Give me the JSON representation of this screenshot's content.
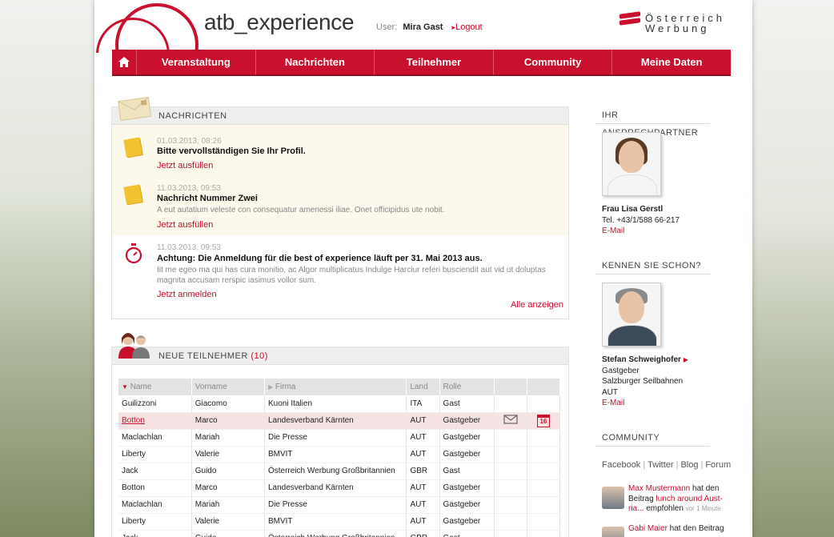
{
  "header": {
    "site_title": "atb_experience",
    "user_label": "User:",
    "user_name": "Mira Gast",
    "logout": "Logout",
    "brand_line1": "Österreich",
    "brand_line2": "Werbung",
    "brand_color": "#c8102e"
  },
  "nav": {
    "home_icon": "home-icon",
    "items": [
      "Veranstaltung",
      "Nachrichten",
      "Teilnehmer",
      "Community",
      "Meine Daten"
    ]
  },
  "messages": {
    "heading": "NACHRICHTEN",
    "items": [
      {
        "date": "01.03.2013, 08:26",
        "title": "Bitte vervollständigen Sie Ihr Profil.",
        "body": "",
        "action": "Jetzt ausfüllen",
        "icon": "note-icon"
      },
      {
        "date": "11.03.2013, 09:53",
        "title": "Nachricht Nummer Zwei",
        "body": "A eut autatium veleste con consequatur amenessi iliae. Onet officipidus ute nobit.",
        "action": "Jetzt ausfüllen",
        "icon": "note-icon"
      },
      {
        "date": "11.03.2013, 09:53",
        "title": "Achtung: Die Anmeldung für die best of experience läuft per 31. Mai 2013 aus.",
        "body": "Iit me egeo ma qui has cura monitio, ac Algor multiplicatus Indulge Harciur referi busciendit aut vid ut doluptas magnita accusam rerspic iasimus vollor sum.",
        "action": "Jetzt anmelden",
        "icon": "stopwatch-icon"
      }
    ],
    "show_all": "Alle anzeigen"
  },
  "participants": {
    "heading": "NEUE TEILNEHMER",
    "count": "(10)",
    "columns": [
      "Name",
      "Vorname",
      "Firma",
      "Land",
      "Rolle"
    ],
    "rows": [
      [
        "Guilizzoni",
        "Giacomo",
        "Kuoni Italien",
        "ITA",
        "Gast"
      ],
      [
        "Botton",
        "Marco",
        "Landesverband Kärnten",
        "AUT",
        "Gastgeber"
      ],
      [
        "Maclachlan",
        "Mariah",
        "Die Presse",
        "AUT",
        "Gastgeber"
      ],
      [
        "Liberty",
        "Valerie",
        "BMVIT",
        "AUT",
        "Gastgeber"
      ],
      [
        "Jack",
        "Guido",
        "Österreich Werbung Großbritannien",
        "GBR",
        "Gast"
      ],
      [
        "Botton",
        "Marco",
        "Landesverband Kärnten",
        "AUT",
        "Gastgeber"
      ],
      [
        "Maclachlan",
        "Mariah",
        "Die Presse",
        "AUT",
        "Gastgeber"
      ],
      [
        "Liberty",
        "Valerie",
        "BMVIT",
        "AUT",
        "Gastgeber"
      ],
      [
        "Jack",
        "Guido",
        "Österreich Werbung Großbritannien",
        "GBR",
        "Gast"
      ]
    ],
    "selected_row": 1,
    "calendar_day": "16"
  },
  "contact": {
    "heading": "IHR ANSPRECHPARTNER",
    "name": "Frau Lisa Gerstl",
    "phone": "Tel. +43/1/588 66-217",
    "email": "E-Mail"
  },
  "suggest": {
    "heading": "KENNEN SIE SCHON?",
    "name": "Stefan Schweighofer",
    "role": "Gastgeber",
    "company": "Salzburger Seilbahnen",
    "country": "AUT",
    "email": "E-Mail"
  },
  "community": {
    "heading": "COMMUNITY",
    "links": [
      "Facebook",
      "Twitter",
      "Blog",
      "Forum"
    ],
    "feed": [
      {
        "user": "Max Mustermann",
        "pre": " hat den Beitrag ",
        "link": "lunch around Aust-ria...",
        "post": " empfohlen ",
        "time": "vor 1 Minute"
      },
      {
        "user": "Gabi Maier",
        "pre": " hat den Beitrag",
        "link": "",
        "post": "",
        "time": ""
      }
    ]
  }
}
